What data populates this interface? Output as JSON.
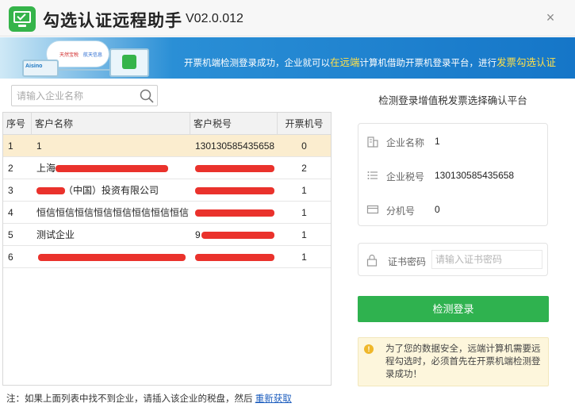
{
  "app": {
    "title": "勾选认证远程助手",
    "version": "V02.0.012",
    "close_label": "×"
  },
  "banner": {
    "cloud_label_1": "天然宝税",
    "cloud_label_2": "航天信息",
    "pc_label": "Aisino",
    "text_1": "开票机端检测登录成功，企业就可以",
    "text_hl_1": "在远端",
    "text_2": "计算机借助开票机登录平台，进行",
    "text_hl_2": "发票勾选认证"
  },
  "search": {
    "placeholder": "请输入企业名称",
    "value": ""
  },
  "table": {
    "headers": [
      "序号",
      "客户名称",
      "客户税号",
      "开票机号"
    ],
    "rows": [
      {
        "no": "1",
        "name": "1",
        "tax": "130130585435658",
        "count": "0",
        "selected": true
      },
      {
        "no": "2",
        "name": "上海",
        "tax": "",
        "count": "2",
        "selected": false
      },
      {
        "no": "3",
        "name": "（中国）投资有限公司",
        "tax": "",
        "count": "1",
        "selected": false
      },
      {
        "no": "4",
        "name": "恒信恒信恒信恒信恒信恒信恒信恒信",
        "tax": "",
        "count": "1",
        "selected": false
      },
      {
        "no": "5",
        "name": "测试企业",
        "tax": "9",
        "count": "1",
        "selected": false
      },
      {
        "no": "6",
        "name": "",
        "tax": "",
        "count": "1",
        "selected": false
      }
    ]
  },
  "note": {
    "text": "注：如果上面列表中找不到企业，请插入该企业的税盘，然后",
    "link": "重新获取"
  },
  "right": {
    "title": "检测登录增值税发票选择确认平台",
    "company_name_label": "企业名称",
    "company_name_value": "1",
    "company_tax_label": "企业税号",
    "company_tax_value": "130130585435658",
    "branch_label": "分机号",
    "branch_value": "0",
    "password_label": "证书密码",
    "password_placeholder": "请输入证书密码",
    "detect_button": "检测登录",
    "tip": "为了您的数据安全，远端计算机需要远程勾选时，必须首先在开票机端检测登录成功！"
  },
  "colors": {
    "accent_green": "#2fb24f",
    "selected_row": "#fbedcf",
    "banner_blue": "#1576c8",
    "highlight_yellow": "#ffe04a",
    "redaction_red": "#e8211a"
  }
}
